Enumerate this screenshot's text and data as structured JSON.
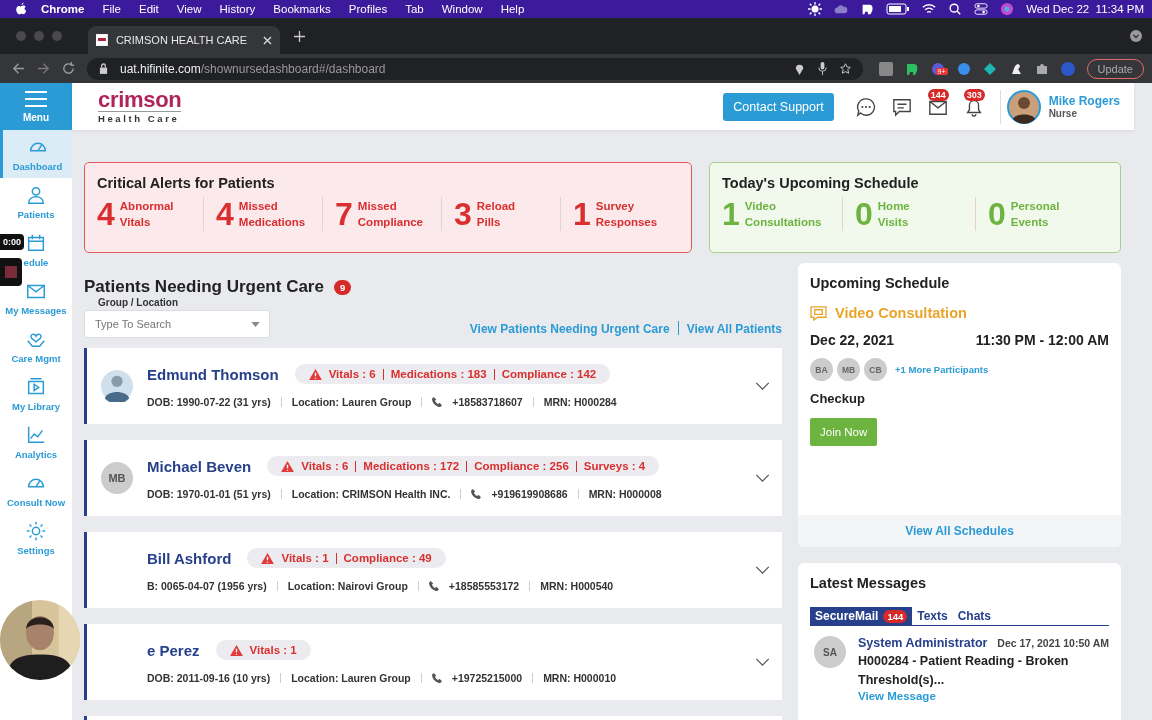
{
  "menubar": {
    "app": "Chrome",
    "menus": [
      "File",
      "Edit",
      "View",
      "History",
      "Bookmarks",
      "Profiles",
      "Tab",
      "Window",
      "Help"
    ],
    "clock": "Wed Dec 22  11:34 PM"
  },
  "browser": {
    "tab_title": "CRIMSON HEALTH CARE",
    "url_host": "uat.hifinite.com",
    "url_path": "/shownursedashboard#/dashboard",
    "extension_badge": "9+",
    "update": "Update"
  },
  "sidebar": {
    "menu_label": "Menu",
    "items": [
      {
        "label": "Dashboard",
        "selected": true
      },
      {
        "label": "Patients",
        "selected": false
      },
      {
        "label": "edule",
        "selected": false
      },
      {
        "label": "My Messages",
        "selected": false
      },
      {
        "label": "Care Mgmt",
        "selected": false
      },
      {
        "label": "My Library",
        "selected": false
      },
      {
        "label": "Analytics",
        "selected": false
      },
      {
        "label": "Consult Now",
        "selected": false
      },
      {
        "label": "Settings",
        "selected": false
      }
    ]
  },
  "header": {
    "logo": "crimson",
    "logo_sub": "Health Care",
    "contact": "Contact Support",
    "mail_count": "144",
    "bell_count": "303",
    "user": "Mike Rogers",
    "role": "Nurse"
  },
  "critical": {
    "title": "Critical Alerts for Patients",
    "items": [
      {
        "count": "4",
        "label": "Abnormal Vitals"
      },
      {
        "count": "4",
        "label": "Missed Medications"
      },
      {
        "count": "7",
        "label": "Missed Compliance"
      },
      {
        "count": "3",
        "label": "Reload Pills"
      },
      {
        "count": "1",
        "label": "Survey Responses"
      }
    ]
  },
  "today": {
    "title": "Today's Upcoming Schedule",
    "items": [
      {
        "count": "1",
        "label": "Video Consultations"
      },
      {
        "count": "0",
        "label": "Home Visits"
      },
      {
        "count": "0",
        "label": "Personal Events"
      }
    ]
  },
  "urgent": {
    "title": "Patients Needing Urgent Care",
    "count": "9",
    "filter_label": "Group / Location",
    "placeholder": "Type To Search",
    "links": [
      "View Patients Needing Urgent Care",
      "View All Patients"
    ],
    "patients": [
      {
        "name": "Edmund Thomson",
        "alerts": [
          {
            "label": "Vitals :",
            "value": "6"
          },
          {
            "label": "Medications :",
            "value": "183"
          },
          {
            "label": "Compliance :",
            "value": "142"
          }
        ],
        "dob": "DOB: 1990-07-22 (31 yrs)",
        "location": "Location: Lauren Group",
        "phone": "+18583718607",
        "mrn": "MRN: H000284"
      },
      {
        "name": "Michael Beven",
        "kind": "initials",
        "initials": "MB",
        "alerts": [
          {
            "label": "Vitals :",
            "value": "6"
          },
          {
            "label": "Medications :",
            "value": "172"
          },
          {
            "label": "Compliance :",
            "value": "256"
          },
          {
            "label": "Surveys :",
            "value": "4"
          }
        ],
        "dob": "DOB: 1970-01-01 (51 yrs)",
        "location": "Location: CRIMSON Health INC.",
        "phone": "+919619908686",
        "mrn": "MRN: H000008"
      },
      {
        "name": "Bill Ashford",
        "alerts": [
          {
            "label": "Vitals :",
            "value": "1"
          },
          {
            "label": "Compliance :",
            "value": "49"
          }
        ],
        "dob": "B: 0065-04-07 (1956 yrs)",
        "location": "Location: Nairovi Group",
        "phone": "+18585553172",
        "mrn": "MRN: H000540"
      },
      {
        "name": "e Perez",
        "alerts": [
          {
            "label": "Vitals :",
            "value": "1"
          }
        ],
        "dob": "DOB: 2011-09-16 (10 yrs)",
        "location": "Location: Lauren Group",
        "phone": "+19725215000",
        "mrn": "MRN: H000010"
      }
    ]
  },
  "schedule": {
    "title": "Upcoming Schedule",
    "type": "Video Consultation",
    "date": "Dec 22, 2021",
    "time": "11:30 PM - 12:00 AM",
    "participants": [
      "BA",
      "MB",
      "CB"
    ],
    "more": "+1 More Participants",
    "subject": "Checkup",
    "join": "Join Now",
    "footer": "View All Schedules"
  },
  "messages": {
    "title": "Latest Messages",
    "tabs": [
      {
        "label": "SecureMail",
        "badge": "144",
        "selected": true
      },
      {
        "label": "Texts",
        "selected": false
      },
      {
        "label": "Chats",
        "selected": false
      }
    ],
    "message": {
      "initials": "SA",
      "sender": "System Administrator",
      "date": "Dec 17, 2021 10:50 AM",
      "text": "H000284 - Patient Reading - Broken Threshold(s)...",
      "link": "View Message"
    }
  },
  "recorder": {
    "time": "0:00"
  }
}
